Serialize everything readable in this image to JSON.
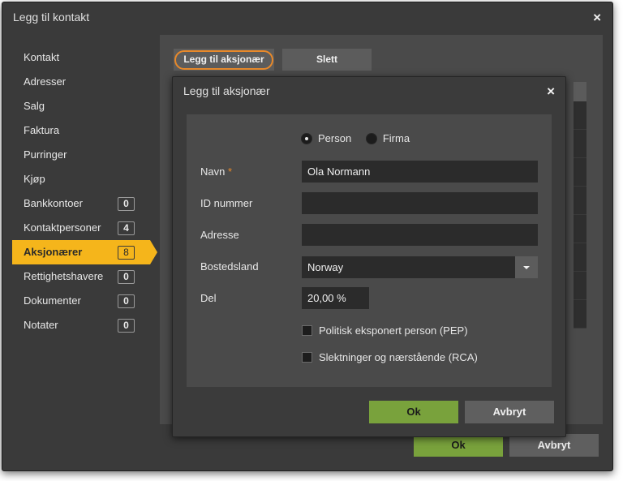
{
  "outer_dialog": {
    "title": "Legg til kontakt",
    "close_icon": "×",
    "ok_label": "Ok",
    "cancel_label": "Avbryt"
  },
  "sidebar": {
    "items": [
      {
        "label": "Kontakt"
      },
      {
        "label": "Adresser"
      },
      {
        "label": "Salg"
      },
      {
        "label": "Faktura"
      },
      {
        "label": "Purringer"
      },
      {
        "label": "Kjøp"
      },
      {
        "label": "Bankkontoer",
        "count": "0"
      },
      {
        "label": "Kontaktpersoner",
        "count": "4"
      },
      {
        "label": "Aksjonærer",
        "count": "8",
        "active": true
      },
      {
        "label": "Rettighetshavere",
        "count": "0"
      },
      {
        "label": "Dokumenter",
        "count": "0"
      },
      {
        "label": "Notater",
        "count": "0"
      }
    ]
  },
  "toolbar": {
    "add_label": "Legg til aksjonær",
    "delete_label": "Slett",
    "highlight_color": "#e8892a"
  },
  "inner_dialog": {
    "title": "Legg til aksjonær",
    "close_icon": "×",
    "type_options": {
      "person": "Person",
      "company": "Firma",
      "selected": "Person"
    },
    "fields": {
      "name": {
        "label": "Navn",
        "required_mark": "*",
        "value": "Ola Normann"
      },
      "id_number": {
        "label": "ID nummer",
        "value": ""
      },
      "address": {
        "label": "Adresse",
        "value": ""
      },
      "country": {
        "label": "Bostedsland",
        "value": "Norway"
      },
      "share": {
        "label": "Del",
        "value": "20,00 %"
      }
    },
    "checkboxes": {
      "pep": {
        "label": "Politisk eksponert person (PEP)",
        "checked": false
      },
      "rca": {
        "label": "Slektninger og nærstående (RCA)",
        "checked": false
      }
    },
    "ok_label": "Ok",
    "cancel_label": "Avbryt"
  },
  "colors": {
    "accent": "#f5b51b",
    "ok_green": "#79a23c",
    "background": "#3a3a3a"
  }
}
